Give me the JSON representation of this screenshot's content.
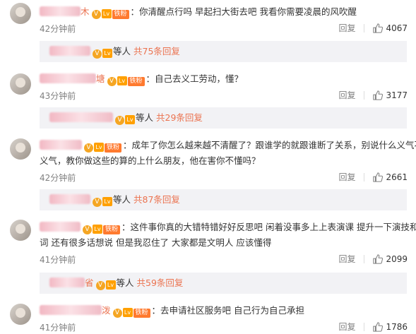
{
  "comments": [
    {
      "name_suffix": "木",
      "fan_label": "铁粉",
      "level_label": "Lv",
      "text": "你清醒点行吗 早起扫大街去吧 我看你需要凌晨的风吹醒",
      "time": "42分钟前",
      "reply_label": "回复",
      "likes": "4067",
      "sub": {
        "et_al": "等人",
        "total": "共75条回复"
      }
    },
    {
      "name_suffix": "塘",
      "fan_label": "铁粉",
      "level_label": "Lv",
      "text": "自己去义工劳动，懂？",
      "time": "43分钟前",
      "reply_label": "回复",
      "likes": "3177",
      "sub": {
        "et_al": "等人",
        "total": "共29条回复"
      }
    },
    {
      "name_suffix": "",
      "fan_label": "铁粉",
      "level_label": "Lv",
      "text_line1": "成年了你怎么越来越不清醒了？跟谁学的就跟谁断了关系，别说什么义气不",
      "text_line2": "义气，教你做这些的算的上什么朋友，他在害你不懂吗？",
      "time": "42分钟前",
      "reply_label": "回复",
      "likes": "2661",
      "sub": {
        "et_al": "等人",
        "total": "共87条回复"
      }
    },
    {
      "name_suffix": "",
      "fan_label": "铁粉",
      "level_label": "Lv",
      "text_line1": "这件事你真的大错特错好好反思吧 闲着没事多上上表演课 提升一下演技和台",
      "text_line2": "词 还有很多话想说 但是我忍住了 大家都是文明人 应该懂得",
      "time": "41分钟前",
      "reply_label": "回复",
      "likes": "2099",
      "sub": {
        "name_suffix": "省",
        "et_al": "等人",
        "total": "共59条回复"
      }
    },
    {
      "name_suffix": "泼",
      "fan_label": "铁粉",
      "level_label": "Lv",
      "text": "去申请社区服务吧 自己行为自己承担",
      "time": "41分钟前",
      "reply_label": "回复",
      "likes": "1786"
    }
  ],
  "icons": {
    "thumb": "thumbs-up-icon",
    "verified": "verified-v-icon"
  },
  "colors": {
    "accent": "#eb7350",
    "muted": "#808080",
    "reply_bg": "#f2f2f5"
  }
}
